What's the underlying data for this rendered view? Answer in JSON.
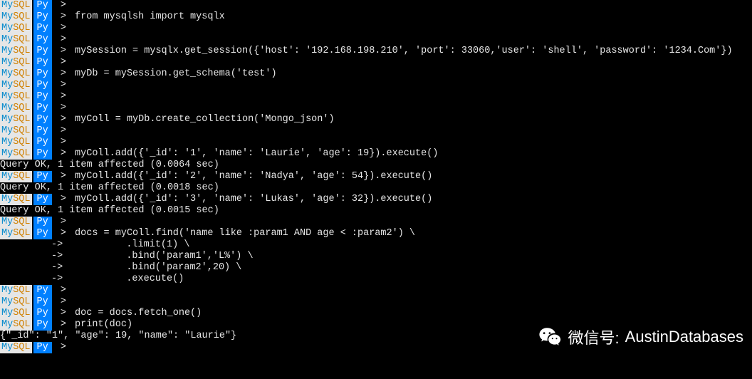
{
  "prompt": {
    "mysql_my": "My",
    "mysql_sql": "SQL",
    "py": "Py",
    "arrow": ">",
    "cont": "->"
  },
  "lines": [
    {
      "t": "prompt",
      "cmd": ""
    },
    {
      "t": "prompt",
      "cmd": "from mysqlsh import mysqlx"
    },
    {
      "t": "prompt",
      "cmd": ""
    },
    {
      "t": "prompt",
      "cmd": ""
    },
    {
      "t": "prompt",
      "cmd": "mySession = mysqlx.get_session({'host': '192.168.198.210', 'port': 33060,'user': 'shell', 'password': '1234.Com'})"
    },
    {
      "t": "prompt",
      "cmd": ""
    },
    {
      "t": "prompt",
      "cmd": "myDb = mySession.get_schema('test')"
    },
    {
      "t": "prompt",
      "cmd": ""
    },
    {
      "t": "prompt",
      "cmd": ""
    },
    {
      "t": "prompt",
      "cmd": ""
    },
    {
      "t": "prompt",
      "cmd": "myColl = myDb.create_collection('Mongo_json')"
    },
    {
      "t": "prompt",
      "cmd": ""
    },
    {
      "t": "prompt",
      "cmd": ""
    },
    {
      "t": "prompt",
      "cmd": "myColl.add({'_id': '1', 'name': 'Laurie', 'age': 19}).execute()"
    },
    {
      "t": "result",
      "cmd": "Query OK, 1 item affected (0.0064 sec)"
    },
    {
      "t": "prompt",
      "cmd": "myColl.add({'_id': '2', 'name': 'Nadya', 'age': 54}).execute()"
    },
    {
      "t": "result",
      "cmd": "Query OK, 1 item affected (0.0018 sec)"
    },
    {
      "t": "prompt",
      "cmd": "myColl.add({'_id': '3', 'name': 'Lukas', 'age': 32}).execute()"
    },
    {
      "t": "result",
      "cmd": "Query OK, 1 item affected (0.0015 sec)"
    },
    {
      "t": "prompt",
      "cmd": ""
    },
    {
      "t": "prompt",
      "cmd": "docs = myColl.find('name like :param1 AND age < :param2') \\"
    },
    {
      "t": "cont",
      "cmd": "          .limit(1) \\"
    },
    {
      "t": "cont",
      "cmd": "          .bind('param1','L%') \\"
    },
    {
      "t": "cont",
      "cmd": "          .bind('param2',20) \\"
    },
    {
      "t": "cont",
      "cmd": "          .execute()"
    },
    {
      "t": "prompt",
      "cmd": ""
    },
    {
      "t": "prompt",
      "cmd": ""
    },
    {
      "t": "prompt",
      "cmd": "doc = docs.fetch_one()"
    },
    {
      "t": "prompt",
      "cmd": "print(doc)"
    },
    {
      "t": "result",
      "cmd": "{\"_id\": \"1\", \"age\": 19, \"name\": \"Laurie\"}"
    },
    {
      "t": "prompt",
      "cmd": ""
    }
  ],
  "watermark": {
    "label": "微信号:",
    "value": "AustinDatabases"
  }
}
